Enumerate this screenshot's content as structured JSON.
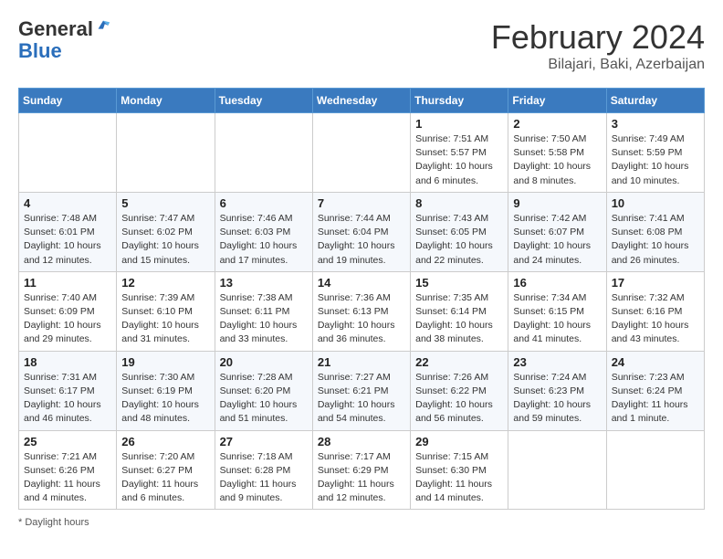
{
  "header": {
    "logo_general": "General",
    "logo_blue": "Blue",
    "month_title": "February 2024",
    "location": "Bilajari, Baki, Azerbaijan"
  },
  "days_of_week": [
    "Sunday",
    "Monday",
    "Tuesday",
    "Wednesday",
    "Thursday",
    "Friday",
    "Saturday"
  ],
  "weeks": [
    [
      {
        "day": "",
        "info": ""
      },
      {
        "day": "",
        "info": ""
      },
      {
        "day": "",
        "info": ""
      },
      {
        "day": "",
        "info": ""
      },
      {
        "day": "1",
        "info": "Sunrise: 7:51 AM\nSunset: 5:57 PM\nDaylight: 10 hours and 6 minutes."
      },
      {
        "day": "2",
        "info": "Sunrise: 7:50 AM\nSunset: 5:58 PM\nDaylight: 10 hours and 8 minutes."
      },
      {
        "day": "3",
        "info": "Sunrise: 7:49 AM\nSunset: 5:59 PM\nDaylight: 10 hours and 10 minutes."
      }
    ],
    [
      {
        "day": "4",
        "info": "Sunrise: 7:48 AM\nSunset: 6:01 PM\nDaylight: 10 hours and 12 minutes."
      },
      {
        "day": "5",
        "info": "Sunrise: 7:47 AM\nSunset: 6:02 PM\nDaylight: 10 hours and 15 minutes."
      },
      {
        "day": "6",
        "info": "Sunrise: 7:46 AM\nSunset: 6:03 PM\nDaylight: 10 hours and 17 minutes."
      },
      {
        "day": "7",
        "info": "Sunrise: 7:44 AM\nSunset: 6:04 PM\nDaylight: 10 hours and 19 minutes."
      },
      {
        "day": "8",
        "info": "Sunrise: 7:43 AM\nSunset: 6:05 PM\nDaylight: 10 hours and 22 minutes."
      },
      {
        "day": "9",
        "info": "Sunrise: 7:42 AM\nSunset: 6:07 PM\nDaylight: 10 hours and 24 minutes."
      },
      {
        "day": "10",
        "info": "Sunrise: 7:41 AM\nSunset: 6:08 PM\nDaylight: 10 hours and 26 minutes."
      }
    ],
    [
      {
        "day": "11",
        "info": "Sunrise: 7:40 AM\nSunset: 6:09 PM\nDaylight: 10 hours and 29 minutes."
      },
      {
        "day": "12",
        "info": "Sunrise: 7:39 AM\nSunset: 6:10 PM\nDaylight: 10 hours and 31 minutes."
      },
      {
        "day": "13",
        "info": "Sunrise: 7:38 AM\nSunset: 6:11 PM\nDaylight: 10 hours and 33 minutes."
      },
      {
        "day": "14",
        "info": "Sunrise: 7:36 AM\nSunset: 6:13 PM\nDaylight: 10 hours and 36 minutes."
      },
      {
        "day": "15",
        "info": "Sunrise: 7:35 AM\nSunset: 6:14 PM\nDaylight: 10 hours and 38 minutes."
      },
      {
        "day": "16",
        "info": "Sunrise: 7:34 AM\nSunset: 6:15 PM\nDaylight: 10 hours and 41 minutes."
      },
      {
        "day": "17",
        "info": "Sunrise: 7:32 AM\nSunset: 6:16 PM\nDaylight: 10 hours and 43 minutes."
      }
    ],
    [
      {
        "day": "18",
        "info": "Sunrise: 7:31 AM\nSunset: 6:17 PM\nDaylight: 10 hours and 46 minutes."
      },
      {
        "day": "19",
        "info": "Sunrise: 7:30 AM\nSunset: 6:19 PM\nDaylight: 10 hours and 48 minutes."
      },
      {
        "day": "20",
        "info": "Sunrise: 7:28 AM\nSunset: 6:20 PM\nDaylight: 10 hours and 51 minutes."
      },
      {
        "day": "21",
        "info": "Sunrise: 7:27 AM\nSunset: 6:21 PM\nDaylight: 10 hours and 54 minutes."
      },
      {
        "day": "22",
        "info": "Sunrise: 7:26 AM\nSunset: 6:22 PM\nDaylight: 10 hours and 56 minutes."
      },
      {
        "day": "23",
        "info": "Sunrise: 7:24 AM\nSunset: 6:23 PM\nDaylight: 10 hours and 59 minutes."
      },
      {
        "day": "24",
        "info": "Sunrise: 7:23 AM\nSunset: 6:24 PM\nDaylight: 11 hours and 1 minute."
      }
    ],
    [
      {
        "day": "25",
        "info": "Sunrise: 7:21 AM\nSunset: 6:26 PM\nDaylight: 11 hours and 4 minutes."
      },
      {
        "day": "26",
        "info": "Sunrise: 7:20 AM\nSunset: 6:27 PM\nDaylight: 11 hours and 6 minutes."
      },
      {
        "day": "27",
        "info": "Sunrise: 7:18 AM\nSunset: 6:28 PM\nDaylight: 11 hours and 9 minutes."
      },
      {
        "day": "28",
        "info": "Sunrise: 7:17 AM\nSunset: 6:29 PM\nDaylight: 11 hours and 12 minutes."
      },
      {
        "day": "29",
        "info": "Sunrise: 7:15 AM\nSunset: 6:30 PM\nDaylight: 11 hours and 14 minutes."
      },
      {
        "day": "",
        "info": ""
      },
      {
        "day": "",
        "info": ""
      }
    ]
  ],
  "footer": {
    "note": "Daylight hours"
  }
}
